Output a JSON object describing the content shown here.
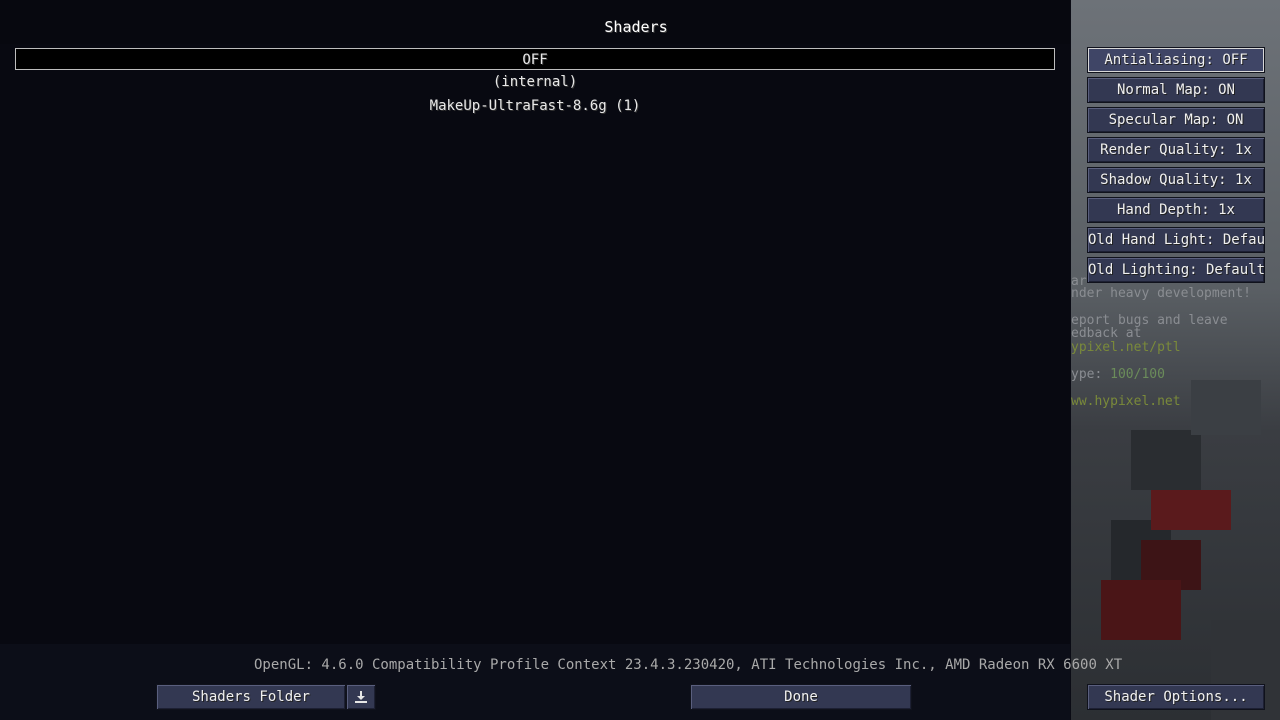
{
  "screen": {
    "title": "Shaders"
  },
  "shader_list": [
    {
      "label": "OFF",
      "selected": true
    },
    {
      "label": "(internal)",
      "selected": false
    },
    {
      "label": "MakeUp-UltraFast-8.6g (1)",
      "selected": false
    }
  ],
  "gl_info": "OpenGL: 4.6.0 Compatibility Profile Context 23.4.3.230420, ATI Technologies Inc., AMD Radeon RX 6600 XT",
  "buttons": {
    "shaders_folder": "Shaders Folder",
    "done": "Done",
    "shader_options": "Shader Options..."
  },
  "options": [
    "Antialiasing: OFF",
    "Normal Map: ON",
    "Specular Map: ON",
    "Render Quality: 1x",
    "Shadow Quality: 1x",
    "Hand Depth: 1x",
    "Old Hand Light: Default",
    "Old Lighting: Default"
  ],
  "background_text": {
    "line1": "ar",
    "line2": "nder heavy development!",
    "line3": "eport bugs and leave",
    "line4": "edback at",
    "line5": "ypixel.net/ptl",
    "line6_prefix": "ype:",
    "line6_value": "100/100",
    "line7": "ww.hypixel.net"
  },
  "colors": {
    "button": "#333852",
    "panel": "#07080f",
    "text": "#e6e6e6"
  }
}
